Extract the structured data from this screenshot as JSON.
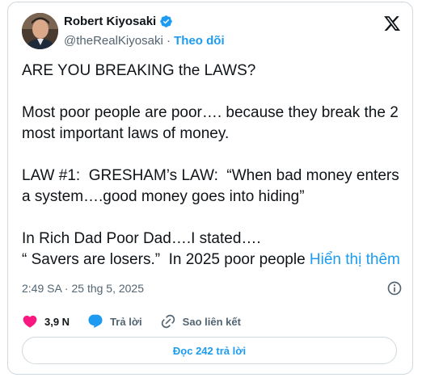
{
  "author": {
    "name": "Robert Kiyosaki",
    "handle": "@theRealKiyosaki",
    "separator": " · ",
    "follow_label": "Theo dõi",
    "verified": true
  },
  "tweet": {
    "paragraphs": [
      "ARE YOU BREAKING the LAWS?",
      "Most poor people are poor…. because they break the 2 most important laws of money.",
      "LAW #1:  GRESHAM’s LAW:  “When bad money enters a system….good money goes into hiding”"
    ],
    "last_paragraph_line1": "In Rich Dad Poor Dad….I stated….",
    "last_paragraph_line2": "“ Savers are losers.”  In 2025 poor people ",
    "show_more_label": "Hiển thị thêm",
    "timestamp": "2:49 SA · 25 thg 5, 2025"
  },
  "actions": {
    "likes_count": "3,9 N",
    "reply_label": "Trả lời",
    "copy_link_label": "Sao liên kết"
  },
  "read_replies_label": "Đọc 242 trả lời",
  "colors": {
    "accent": "#1d9bf0",
    "like": "#f91880",
    "muted": "#536471"
  },
  "icons": [
    "verified-badge-icon",
    "x-logo-icon",
    "info-icon",
    "heart-icon",
    "reply-bubble-icon",
    "link-icon"
  ]
}
